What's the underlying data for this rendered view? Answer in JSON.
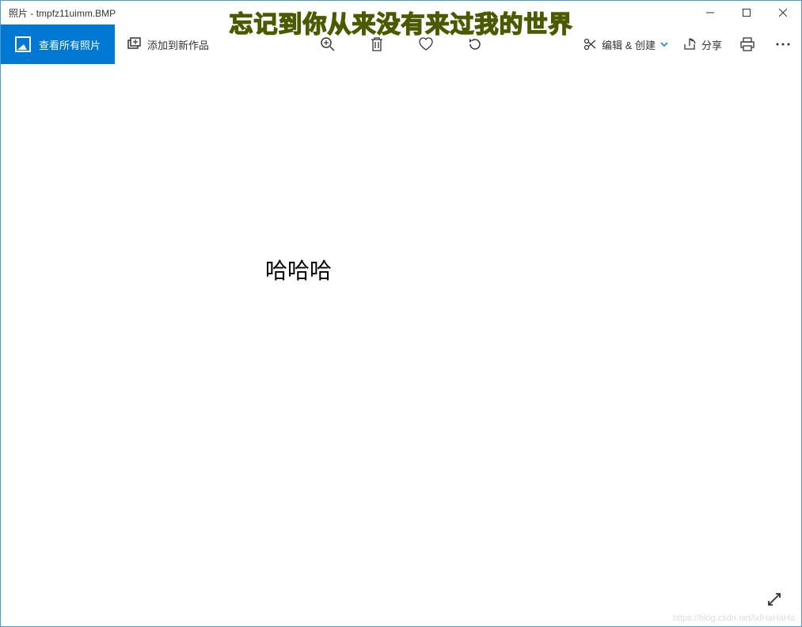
{
  "titlebar": {
    "app_name": "照片",
    "file_name": "tmpfz11uimm.BMP"
  },
  "overlay": {
    "caption": "忘记到你从来没有来过我的世界"
  },
  "toolbar": {
    "view_all_label": "查看所有照片",
    "add_creation_label": "添加到新作品",
    "edit_create_label": "编辑 & 创建",
    "share_label": "分享"
  },
  "content": {
    "image_text": "哈哈哈"
  },
  "watermark": {
    "text": "https://blog.csdn.net/lxlHaHaHa"
  }
}
